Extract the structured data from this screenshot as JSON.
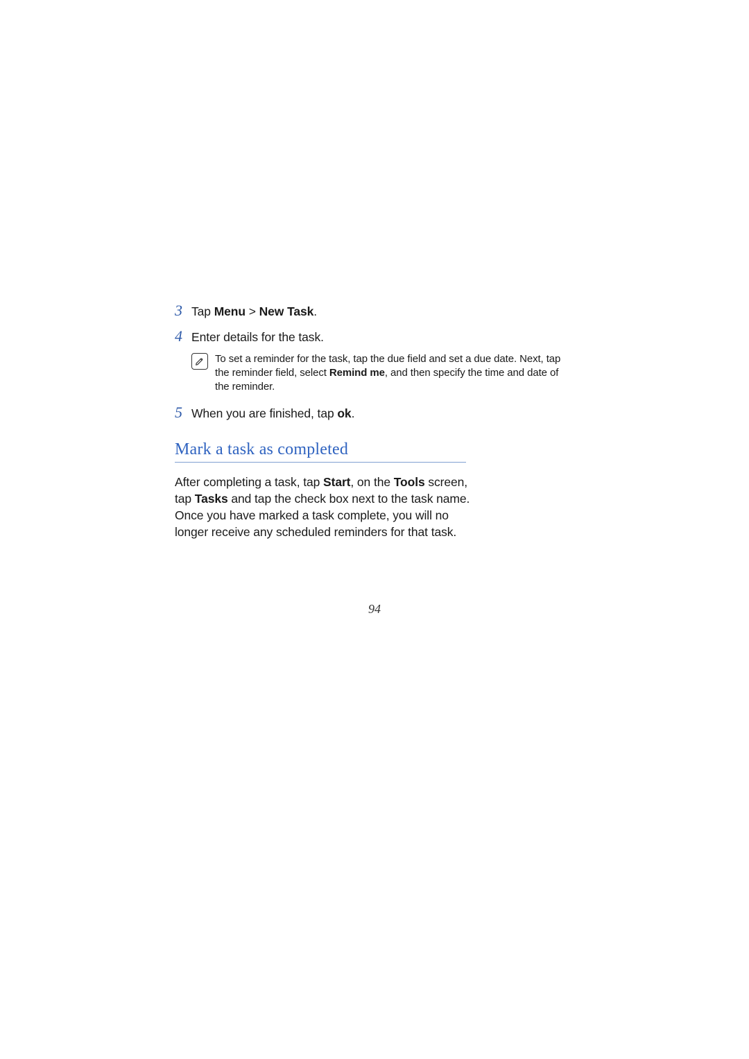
{
  "steps": {
    "s3": {
      "num": "3",
      "pre": "Tap ",
      "b1": "Menu",
      "mid": " > ",
      "b2": "New Task",
      "post": "."
    },
    "s4": {
      "num": "4",
      "text": "Enter details for the task."
    },
    "s5": {
      "num": "5",
      "pre": "When you are finished, tap ",
      "b1": "ok",
      "post": "."
    }
  },
  "note": {
    "icon_name": "note-pencil-icon",
    "pre": "To set a reminder for the task, tap the due field and set a due date. Next, tap the reminder field, select ",
    "b1": "Remind me",
    "post": ", and then specify the time and date of the reminder."
  },
  "section": {
    "title": "Mark a task as completed",
    "para_pre": "After completing a task, tap ",
    "para_b1": "Start",
    "para_mid1": ", on the ",
    "para_b2": "Tools",
    "para_mid2": " screen, tap ",
    "para_b3": "Tasks",
    "para_post": " and tap the check box next to the task name. Once you have marked a task complete, you will no longer receive any scheduled reminders for that task."
  },
  "page_number": "94",
  "colors": {
    "accent": "#2f63c0",
    "rule": "#7fa0d2"
  }
}
